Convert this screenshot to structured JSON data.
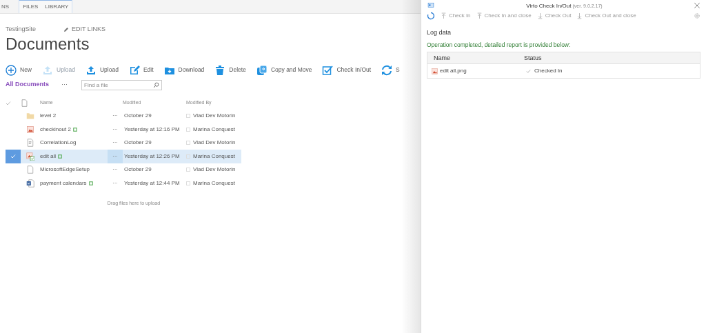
{
  "ribbon": {
    "tabs": [
      {
        "label": "NS"
      }
    ],
    "context_tabs": [
      {
        "label": "FILES"
      },
      {
        "label": "LIBRARY"
      }
    ]
  },
  "breadcrumb": {
    "site": "TestingSite",
    "edit_links": "EDIT LINKS"
  },
  "page_title": "Documents",
  "toolbar": [
    {
      "label": "New",
      "kind": "new",
      "disabled": false
    },
    {
      "label": "Upload",
      "kind": "upload",
      "disabled": true
    },
    {
      "label": "Upload",
      "kind": "upload",
      "disabled": false
    },
    {
      "label": "Edit",
      "kind": "edit",
      "disabled": false
    },
    {
      "label": "Download",
      "kind": "download",
      "disabled": false
    },
    {
      "label": "Delete",
      "kind": "delete",
      "disabled": false
    },
    {
      "label": "Copy and Move",
      "kind": "copy",
      "disabled": false
    },
    {
      "label": "Check In/Out",
      "kind": "check",
      "disabled": false
    },
    {
      "label": "S",
      "kind": "sync",
      "disabled": false
    }
  ],
  "view": {
    "label": "All Documents",
    "more": "···",
    "search_placeholder": "Find a file"
  },
  "table": {
    "columns": [
      "Name",
      "Modified",
      "Modified By"
    ],
    "rows": [
      {
        "kind": "folder",
        "name": "level 2",
        "new": false,
        "selected": false,
        "modified": "October 29",
        "modified_by": "Vlad Dev Motorin"
      },
      {
        "kind": "image",
        "name": "checkinout 2",
        "new": true,
        "selected": false,
        "modified": "Yesterday at 12:16 PM",
        "modified_by": "Marina Conquest"
      },
      {
        "kind": "text",
        "name": "CorrelationLog",
        "new": false,
        "selected": false,
        "modified": "October 29",
        "modified_by": "Vlad Dev Motorin"
      },
      {
        "kind": "image-checked-out",
        "name": "edit all",
        "new": true,
        "selected": true,
        "modified": "Yesterday at 12:26 PM",
        "modified_by": "Marina Conquest"
      },
      {
        "kind": "file",
        "name": "MicrosoftEdgeSetup",
        "new": false,
        "selected": false,
        "modified": "October 29",
        "modified_by": "Vlad Dev Motorin"
      },
      {
        "kind": "word",
        "name": "payment calendars",
        "new": true,
        "selected": false,
        "modified": "Yesterday at 12:44 PM",
        "modified_by": "Marina Conquest"
      }
    ],
    "row_menu": "···",
    "drop_hint": "Drag files here to upload"
  },
  "panel": {
    "title": "Virto Check In/Out",
    "version": "(ver. 9.0.2.17)",
    "actions": [
      {
        "label": "Check In",
        "kind": "in",
        "disabled": true
      },
      {
        "label": "Check In and close",
        "kind": "in",
        "disabled": true
      },
      {
        "label": "Check Out",
        "kind": "out",
        "disabled": true
      },
      {
        "label": "Check Out and close",
        "kind": "out",
        "disabled": true
      }
    ],
    "log_heading": "Log data",
    "message": "Operation completed, detailed report is provided below:",
    "log_columns": [
      "Name",
      "Status"
    ],
    "log_rows": [
      {
        "name": "edit all.png",
        "status": "Checked In"
      }
    ]
  }
}
